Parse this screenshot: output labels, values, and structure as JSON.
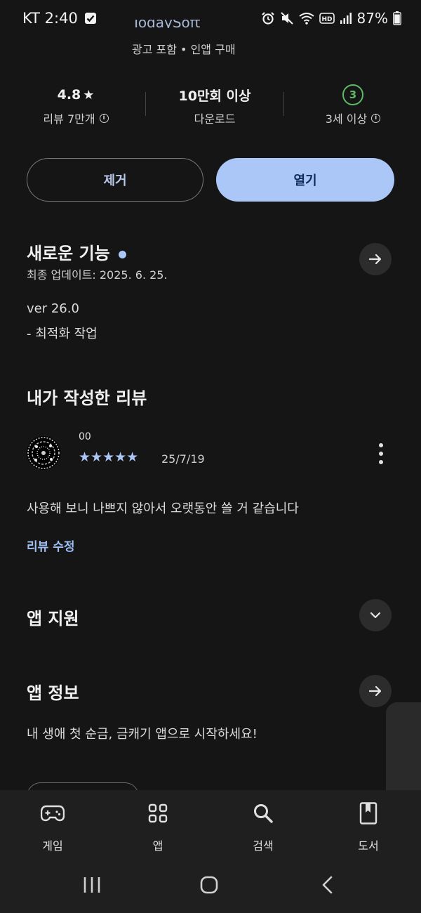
{
  "status_bar": {
    "carrier_time": "KT 2:40",
    "battery": "87%",
    "icons": [
      "checkbox-icon",
      "alarm-icon",
      "mute-icon",
      "wifi-icon",
      "hd-icon",
      "signal-icon",
      "battery-icon"
    ]
  },
  "app_header": {
    "title_cut": "TodaySoft",
    "ads_iap": "광고 포함 • 인앱 구매"
  },
  "stats": {
    "rating_value": "4.8",
    "rating_star": "★",
    "rating_label": "리뷰 7만개",
    "downloads_value": "10만회 이상",
    "downloads_label": "다운로드",
    "age_badge": "3",
    "age_label": "3세 이상"
  },
  "actions": {
    "remove_label": "제거",
    "open_label": "열기"
  },
  "whats_new": {
    "heading": "새로운 기능",
    "updated": "최종 업데이트: 2025. 6. 25.",
    "version": "ver 26.0",
    "note": "- 최적화 작업"
  },
  "my_review": {
    "heading": "내가 작성한 리뷰",
    "author": "00",
    "stars": "★★★★★",
    "rating": 5,
    "date": "25/7/19",
    "text": "사용해 보니 나쁘지 않아서 오랫동안 쓸 거 같습니다",
    "edit_label": "리뷰 수정"
  },
  "app_support": {
    "heading": "앱 지원"
  },
  "app_info": {
    "heading": "앱 정보",
    "description": "내 생애 첫 순금, 금캐기 앱으로 시작하세요!"
  },
  "bottom_nav": {
    "items": [
      {
        "label": "게임",
        "icon": "gamepad-icon"
      },
      {
        "label": "앱",
        "icon": "apps-grid-icon"
      },
      {
        "label": "검색",
        "icon": "search-icon"
      },
      {
        "label": "도서",
        "icon": "book-icon"
      }
    ]
  },
  "colors": {
    "background": "#151515",
    "accent": "#aac7f8",
    "age_green": "#5fb865"
  }
}
